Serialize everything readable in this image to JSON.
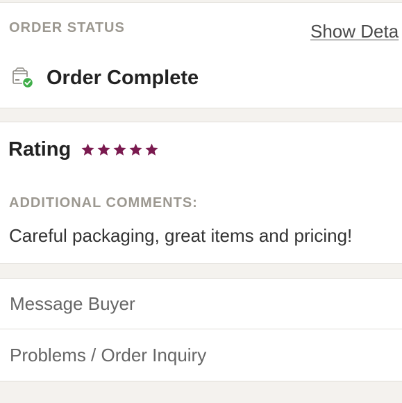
{
  "order_status": {
    "section_label": "ORDER STATUS",
    "show_details_label": "Show Deta",
    "status_icon": "package-complete-icon",
    "status_text": "Order Complete",
    "status_color": "#3fae49"
  },
  "rating": {
    "label": "Rating",
    "stars_value": 5,
    "stars_max": 5,
    "star_icon": "star-icon",
    "star_color": "#7a1a4f"
  },
  "comments": {
    "label": "ADDITIONAL COMMENTS:",
    "text": "Careful packaging, great items and pricing!"
  },
  "actions": {
    "message_buyer": "Message Buyer",
    "problems_inquiry": "Problems / Order Inquiry"
  },
  "colors": {
    "background": "#ffffff",
    "band": "#f4f2ee",
    "divider": "#e0ddd8",
    "muted_label": "#9c9890"
  }
}
